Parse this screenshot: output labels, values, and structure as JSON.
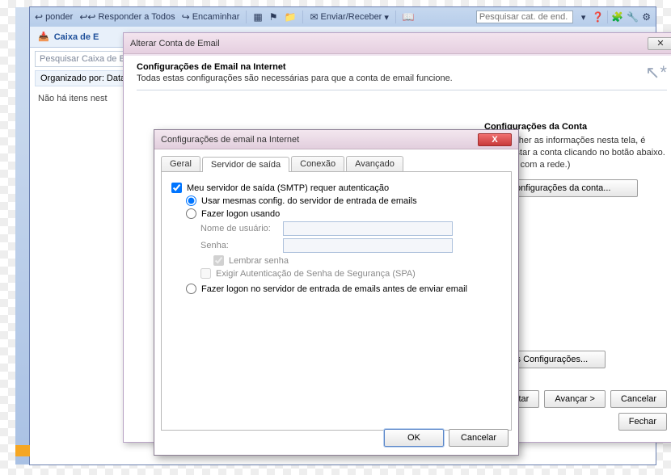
{
  "toolbar": {
    "reply": "ponder",
    "reply_all": "Responder a Todos",
    "forward": "Encaminhar",
    "send_receive": "Enviar/Receber",
    "search_placeholder": "Pesquisar cat. de end."
  },
  "inbox": {
    "title": "Caixa de E",
    "search_placeholder": "Pesquisar Caixa de E",
    "organized_by": "Organizado por: Data",
    "noitems_line": "Não há itens nest       exibiçã"
  },
  "dlg1": {
    "title": "Alterar Conta de Email",
    "header_bold": "Configurações de Email na Internet",
    "header_sub": "Todas estas configurações são necessárias para que a conta de email funcione.",
    "acct_title": "Configurações da Conta",
    "acct_desc": "e preencher as informações nesta tela, é dável testar a conta clicando no botão abaixo. conexão com a rede.)",
    "test_btn": "configurações da conta...",
    "more": "Mais Configurações...",
    "back": "< Voltar",
    "next": "Avançar >",
    "cancel": "Cancelar",
    "close": "Fechar"
  },
  "dlg2": {
    "title": "Configurações de email na Internet",
    "tabs": {
      "general": "Geral",
      "outgoing": "Servidor de saída",
      "connection": "Conexão",
      "advanced": "Avançado"
    },
    "chk_smtp": "Meu servidor de saída (SMTP) requer autenticação",
    "opt_same": "Usar mesmas config. do servidor de entrada de emails",
    "opt_logon": "Fazer logon usando",
    "lbl_user": "Nome de usuário:",
    "lbl_pass": "Senha:",
    "chk_remember": "Lembrar senha",
    "chk_spa": "Exigir Autenticação de Senha de Segurança (SPA)",
    "opt_before": "Fazer logon no servidor de entrada de emails antes de enviar email",
    "ok": "OK",
    "cancel": "Cancelar"
  }
}
